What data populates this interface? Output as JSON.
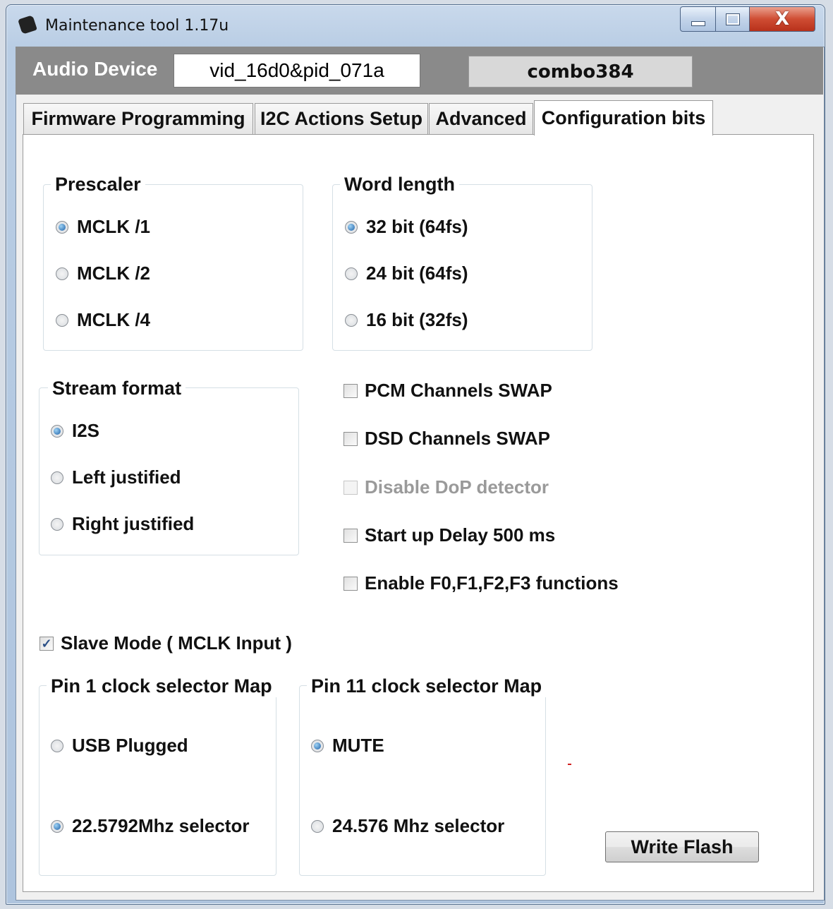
{
  "window": {
    "title": "Maintenance tool 1.17u",
    "close_glyph": "X"
  },
  "header": {
    "label": "Audio Device",
    "vid_pid": "vid_16d0&pid_071a",
    "device_name": "combo384"
  },
  "tabs": [
    {
      "label": "Firmware Programming",
      "active": false
    },
    {
      "label": "I2C Actions Setup",
      "active": false
    },
    {
      "label": "Advanced",
      "active": false
    },
    {
      "label": "Configuration bits",
      "active": true
    }
  ],
  "prescaler": {
    "title": "Prescaler",
    "options": [
      "MCLK /1",
      "MCLK /2",
      "MCLK /4"
    ],
    "selected": "MCLK /1"
  },
  "word_length": {
    "title": "Word length",
    "options": [
      "32 bit (64fs)",
      "24 bit (64fs)",
      "16 bit (32fs)"
    ],
    "selected": "32 bit (64fs)"
  },
  "stream_format": {
    "title": "Stream format",
    "options": [
      "I2S",
      "Left justified",
      "Right justified"
    ],
    "selected": "I2S"
  },
  "checkboxes": [
    {
      "label": "PCM Channels SWAP",
      "checked": false,
      "enabled": true
    },
    {
      "label": "DSD Channels SWAP",
      "checked": false,
      "enabled": true
    },
    {
      "label": "Disable DoP detector",
      "checked": false,
      "enabled": false
    },
    {
      "label": "Start up Delay 500 ms",
      "checked": false,
      "enabled": true
    },
    {
      "label": "Enable F0,F1,F2,F3 functions",
      "checked": false,
      "enabled": true
    }
  ],
  "slave_mode": {
    "label": "Slave Mode ( MCLK Input )",
    "checked": true
  },
  "pin1_map": {
    "title": "Pin 1 clock selector Map",
    "options": [
      "USB Plugged",
      "22.5792Mhz selector"
    ],
    "selected": "22.5792Mhz selector"
  },
  "pin11_map": {
    "title": "Pin 11 clock selector Map",
    "options": [
      "MUTE",
      "24.576 Mhz selector"
    ],
    "selected": "MUTE"
  },
  "buttons": {
    "write_flash": "Write Flash"
  },
  "colors": {
    "header_bg": "#8a8a8a",
    "radio_selected": "#1c5fa6",
    "close_button": "#cf4d33"
  }
}
